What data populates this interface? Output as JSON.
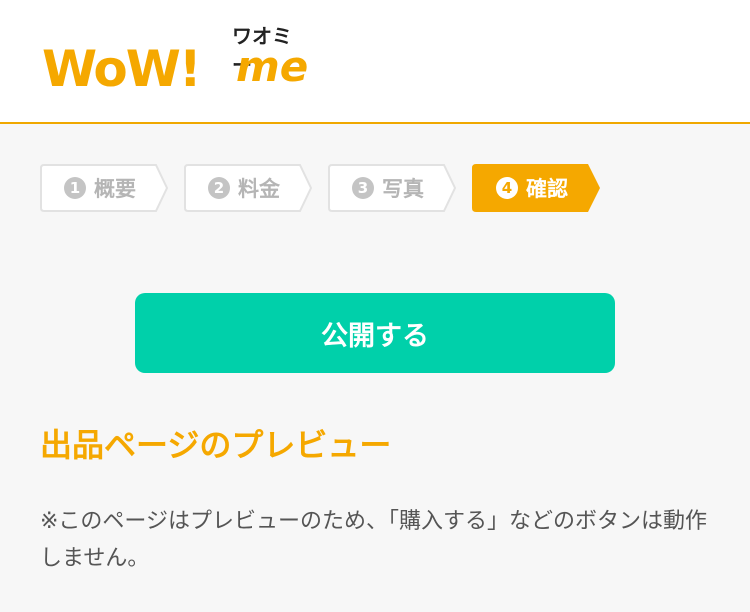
{
  "brand": {
    "logo_main": "WoW!",
    "logo_sub": "me",
    "logo_kana": "ワオミー",
    "accent_color": "#f5a800"
  },
  "steps": [
    {
      "num": "1",
      "label": "概要",
      "active": false
    },
    {
      "num": "2",
      "label": "料金",
      "active": false
    },
    {
      "num": "3",
      "label": "写真",
      "active": false
    },
    {
      "num": "4",
      "label": "確認",
      "active": true
    }
  ],
  "actions": {
    "publish_label": "公開する",
    "publish_color": "#00d0aa"
  },
  "preview": {
    "title": "出品ページのプレビュー",
    "note": "※このページはプレビューのため、「購入する」などのボタンは動作しません。"
  }
}
